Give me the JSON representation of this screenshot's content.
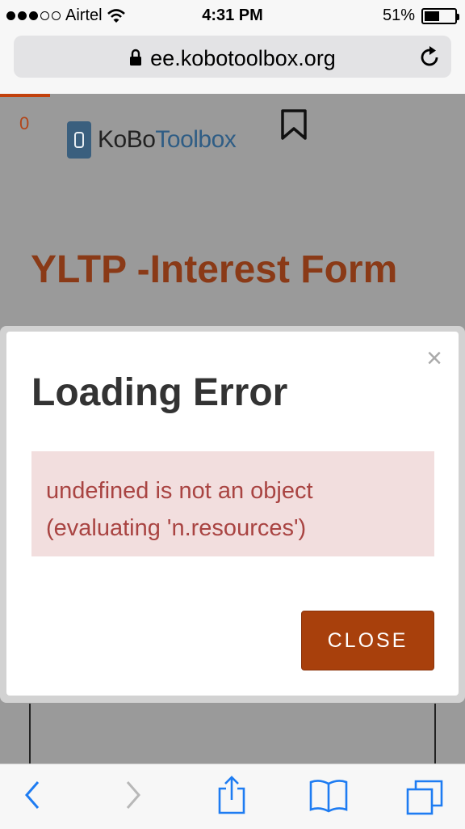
{
  "status_bar": {
    "carrier": "Airtel",
    "time": "4:31 PM",
    "battery_percent": "51%",
    "battery_level": 0.51,
    "signal_bars_filled": 3,
    "signal_bars_total": 5
  },
  "browser": {
    "url": "ee.kobotoolbox.org"
  },
  "page": {
    "counter": "0",
    "logo": {
      "part1": "KoBo",
      "part2": "Toolbox"
    },
    "form_title": "YLTP -Interest Form"
  },
  "modal": {
    "close_symbol": "×",
    "title": "Loading Error",
    "error_line1": "undefined is not an object",
    "error_line2": "(evaluating 'n.resources')",
    "close_button": "CLOSE"
  },
  "icons": {
    "lock": "lock-icon",
    "reload": "reload-icon",
    "bookmark": "bookmark-icon",
    "back": "chevron-left-icon",
    "forward": "chevron-right-icon",
    "share": "share-icon",
    "bookmarks": "book-icon",
    "tabs": "tabs-icon"
  },
  "colors": {
    "accent": "#a8400c",
    "error_text": "#a94442",
    "error_bg": "#f2dede",
    "ios_blue": "#1e7cf2"
  }
}
